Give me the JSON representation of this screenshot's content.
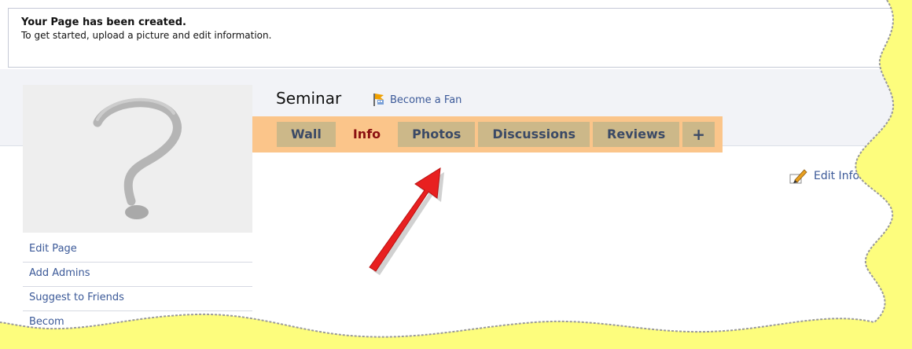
{
  "notice": {
    "title": "Your Page has been created.",
    "body": "To get started, upload a picture and edit information."
  },
  "profile": {
    "name": "Seminar",
    "fan_link": "Become a Fan",
    "picture_icon": "question-mark-placeholder"
  },
  "tabs": [
    {
      "label": "Wall"
    },
    {
      "label": "Info",
      "active": true
    },
    {
      "label": "Photos"
    },
    {
      "label": "Discussions"
    },
    {
      "label": "Reviews"
    },
    {
      "label": "+"
    }
  ],
  "edit_info_label": "Edit Informati",
  "side_menu": [
    {
      "label": "Edit Page"
    },
    {
      "label": "Add Admins"
    },
    {
      "label": "Suggest to Friends"
    },
    {
      "label": "Becom"
    }
  ],
  "annotation": {
    "arrow_color": "#e82020",
    "highlight_color": "#fbc58a",
    "background_color": "#fdfd7d"
  }
}
